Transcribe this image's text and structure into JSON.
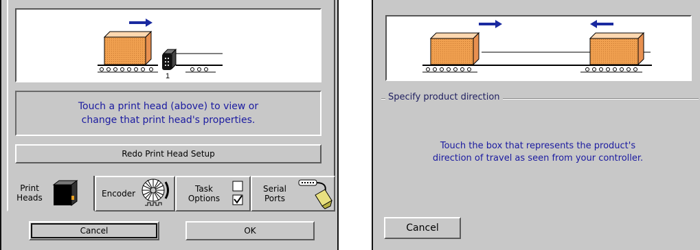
{
  "left": {
    "head_number": "1",
    "info_line1": "Touch a print head (above) to view or",
    "info_line2": "change that print head's properties.",
    "redo_label": "Redo Print Head Setup",
    "tabs": {
      "print_heads": {
        "line1": "Print",
        "line2": "Heads"
      },
      "encoder": {
        "label": "Encoder"
      },
      "task_options": {
        "line1": "Task",
        "line2": "Options"
      },
      "serial_ports": {
        "line1": "Serial",
        "line2": "Ports"
      }
    },
    "cancel_label": "Cancel",
    "ok_label": "OK"
  },
  "right": {
    "group_title": "Specify product direction",
    "info_line1": "Touch the box that represents the product's",
    "info_line2": "direction of travel as seen from your controller.",
    "cancel_label": "Cancel"
  },
  "colors": {
    "panel_bg": "#c8c8c8",
    "info_text": "#1a1aa0",
    "arrow_blue": "#1a2aa0",
    "box_orange": "#f0a050"
  }
}
